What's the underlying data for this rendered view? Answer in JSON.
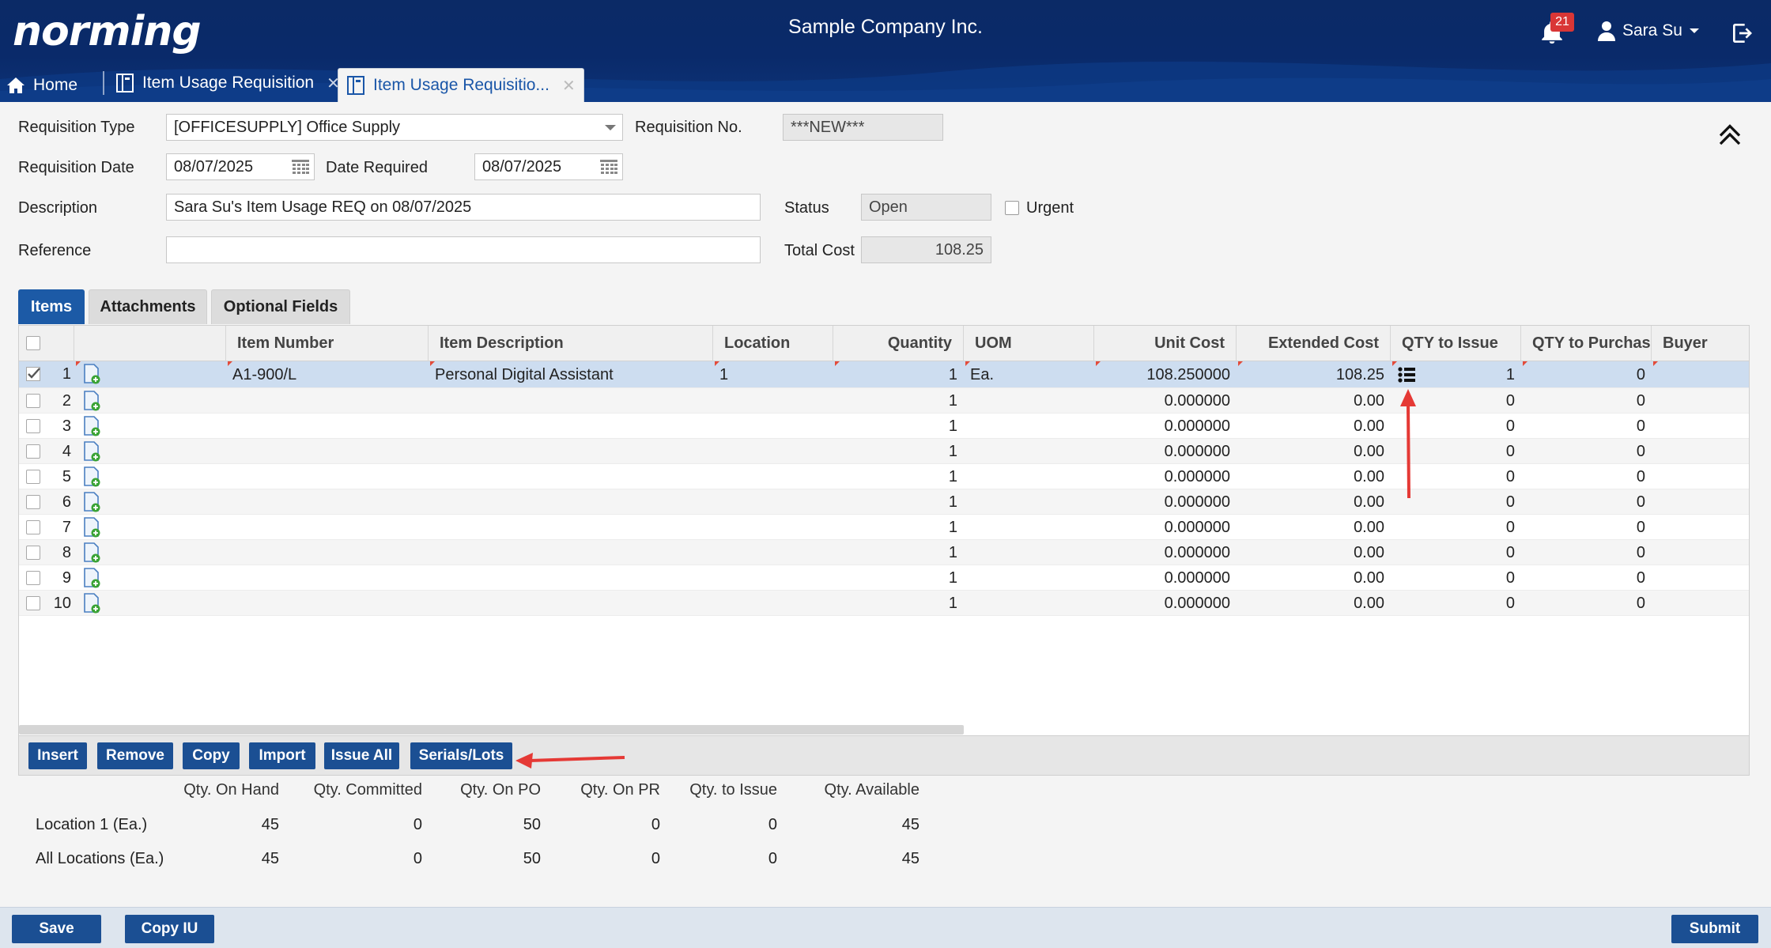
{
  "header": {
    "logo": "norming",
    "company": "Sample Company Inc.",
    "notification_count": "21",
    "user_name": "Sara Su",
    "colors": {
      "header_bg": "#0b2a66",
      "accent": "#1c5aa6",
      "badge": "#d93636"
    }
  },
  "window_tabs": [
    {
      "label": "Home",
      "icon": "home-icon"
    },
    {
      "label": "Item Usage Requisition",
      "icon": "document-icon"
    },
    {
      "label": "Item Usage Requisitio...",
      "icon": "document-icon"
    }
  ],
  "form": {
    "requisition_type_label": "Requisition Type",
    "requisition_type_value": "[OFFICESUPPLY] Office Supply",
    "requisition_no_label": "Requisition No.",
    "requisition_no_value": "***NEW***",
    "requisition_date_label": "Requisition Date",
    "requisition_date_value": "08/07/2025",
    "date_required_label": "Date Required",
    "date_required_value": "08/07/2025",
    "description_label": "Description",
    "description_value": "Sara Su's Item Usage REQ on 08/07/2025",
    "status_label": "Status",
    "status_value": "Open",
    "urgent_label": "Urgent",
    "reference_label": "Reference",
    "reference_value": "",
    "total_cost_label": "Total Cost",
    "total_cost_value": "108.25"
  },
  "section_tabs": [
    "Items",
    "Attachments",
    "Optional Fields"
  ],
  "grid": {
    "columns": [
      "Item Number",
      "Item Description",
      "Location",
      "Quantity",
      "UOM",
      "Unit Cost",
      "Extended Cost",
      "QTY to Issue",
      "QTY to Purchase",
      "Buyer"
    ],
    "rows": [
      {
        "n": "1",
        "item": "A1-900/L",
        "desc": "Personal Digital Assistant",
        "loc": "1",
        "qty": "1",
        "uom": "Ea.",
        "unit": "108.250000",
        "ext": "108.25",
        "issue": "1",
        "purchase": "0"
      },
      {
        "n": "2",
        "item": "",
        "desc": "",
        "loc": "",
        "qty": "1",
        "uom": "",
        "unit": "0.000000",
        "ext": "0.00",
        "issue": "0",
        "purchase": "0"
      },
      {
        "n": "3",
        "item": "",
        "desc": "",
        "loc": "",
        "qty": "1",
        "uom": "",
        "unit": "0.000000",
        "ext": "0.00",
        "issue": "0",
        "purchase": "0"
      },
      {
        "n": "4",
        "item": "",
        "desc": "",
        "loc": "",
        "qty": "1",
        "uom": "",
        "unit": "0.000000",
        "ext": "0.00",
        "issue": "0",
        "purchase": "0"
      },
      {
        "n": "5",
        "item": "",
        "desc": "",
        "loc": "",
        "qty": "1",
        "uom": "",
        "unit": "0.000000",
        "ext": "0.00",
        "issue": "0",
        "purchase": "0"
      },
      {
        "n": "6",
        "item": "",
        "desc": "",
        "loc": "",
        "qty": "1",
        "uom": "",
        "unit": "0.000000",
        "ext": "0.00",
        "issue": "0",
        "purchase": "0"
      },
      {
        "n": "7",
        "item": "",
        "desc": "",
        "loc": "",
        "qty": "1",
        "uom": "",
        "unit": "0.000000",
        "ext": "0.00",
        "issue": "0",
        "purchase": "0"
      },
      {
        "n": "8",
        "item": "",
        "desc": "",
        "loc": "",
        "qty": "1",
        "uom": "",
        "unit": "0.000000",
        "ext": "0.00",
        "issue": "0",
        "purchase": "0"
      },
      {
        "n": "9",
        "item": "",
        "desc": "",
        "loc": "",
        "qty": "1",
        "uom": "",
        "unit": "0.000000",
        "ext": "0.00",
        "issue": "0",
        "purchase": "0"
      },
      {
        "n": "10",
        "item": "",
        "desc": "",
        "loc": "",
        "qty": "1",
        "uom": "",
        "unit": "0.000000",
        "ext": "0.00",
        "issue": "0",
        "purchase": "0"
      }
    ]
  },
  "toolbar": {
    "insert": "Insert",
    "remove": "Remove",
    "copy": "Copy",
    "import": "Import",
    "issue_all": "Issue All",
    "serials_lots": "Serials/Lots"
  },
  "quantities": {
    "headers": [
      "Qty. On Hand",
      "Qty. Committed",
      "Qty. On PO",
      "Qty. On PR",
      "Qty. to Issue",
      "Qty. Available"
    ],
    "rows": [
      {
        "label": "Location 1 (Ea.)",
        "values": [
          "45",
          "0",
          "50",
          "0",
          "0",
          "45"
        ]
      },
      {
        "label": "All Locations (Ea.)",
        "values": [
          "45",
          "0",
          "50",
          "0",
          "0",
          "45"
        ]
      }
    ]
  },
  "footer": {
    "save": "Save",
    "copy_iu": "Copy IU",
    "submit": "Submit"
  }
}
